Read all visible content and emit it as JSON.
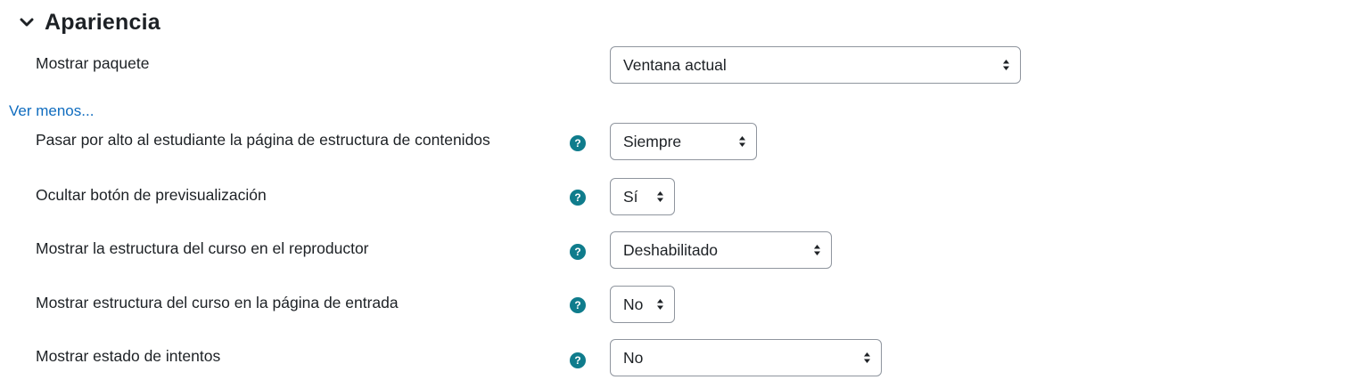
{
  "section": {
    "title": "Apariencia",
    "collapse_icon": "chevron-down-icon"
  },
  "display_package": {
    "label": "Mostrar paquete",
    "value": "Ventana actual"
  },
  "toggle_link": "Ver menos...",
  "settings": [
    {
      "label": "Pasar por alto al estudiante la página de estructura de contenidos",
      "value": "Siempre",
      "help_icon": "question-circle-icon"
    },
    {
      "label": "Ocultar botón de previsualización",
      "value": "Sí",
      "help_icon": "question-circle-icon"
    },
    {
      "label": "Mostrar la estructura del curso en el reproductor",
      "value": "Deshabilitado",
      "help_icon": "question-circle-icon"
    },
    {
      "label": "Mostrar estructura del curso en la página de entrada",
      "value": "No",
      "help_icon": "question-circle-icon"
    },
    {
      "label": "Mostrar estado de intentos",
      "value": "No",
      "help_icon": "question-circle-icon"
    }
  ],
  "colors": {
    "link": "#0f6cbf",
    "help_icon": "#0f7c8c",
    "text": "#1d2125",
    "select_border": "#8f959e"
  }
}
